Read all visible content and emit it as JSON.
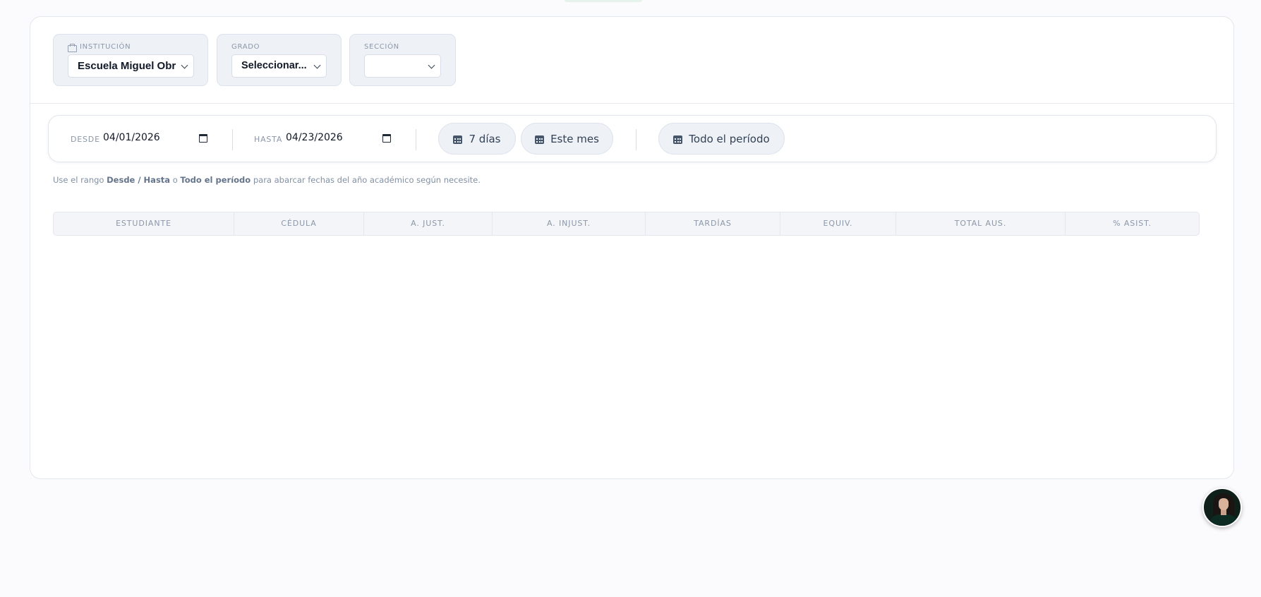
{
  "filters": {
    "institucion": {
      "label": "INSTITUCIÓN",
      "value": "Escuela Miguel Obr"
    },
    "grado": {
      "label": "GRADO",
      "value": "Seleccionar..."
    },
    "seccion": {
      "label": "SECCIÓN",
      "value": ""
    }
  },
  "date_range": {
    "desde_label": "DESDE",
    "desde_value": "04/01/2026",
    "hasta_label": "HASTA",
    "hasta_value": "04/23/2026",
    "btn_7dias": "7 días",
    "btn_este_mes": "Este mes",
    "btn_todo_periodo": "Todo el período"
  },
  "helper": {
    "prefix": "Use el rango ",
    "desde_hasta": "Desde / Hasta",
    "mid": " o ",
    "todo": "Todo el período",
    "suffix": " para abarcar fechas del año académico según necesite."
  },
  "table": {
    "columns": [
      "ESTUDIANTE",
      "CÉDULA",
      "A. JUST.",
      "A. INJUST.",
      "TARDÍAS",
      "EQUIV.",
      "TOTAL AUS.",
      "% ASIST."
    ]
  },
  "colors": {
    "accent": "#eef2f7",
    "border": "#e3e7ee",
    "muted_text": "#8c97a8"
  },
  "icons": [
    "building-icon",
    "chevron-down-icon",
    "calendar-icon",
    "avatar"
  ]
}
